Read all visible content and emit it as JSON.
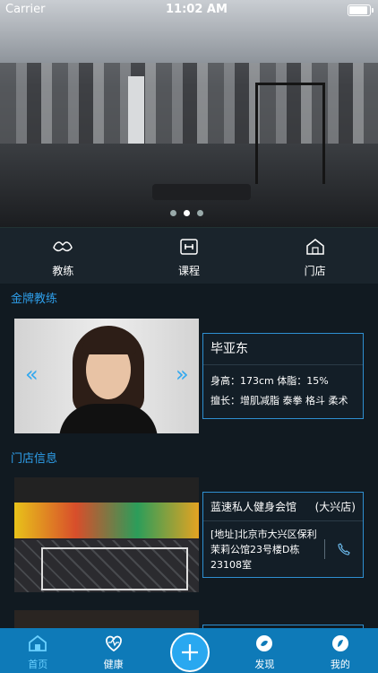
{
  "status": {
    "carrier": "Carrier",
    "time": "11:02 AM"
  },
  "hero": {
    "slides": 3,
    "active_index": 1
  },
  "quick_nav": [
    {
      "label": "教练",
      "icon": "muscle-icon"
    },
    {
      "label": "课程",
      "icon": "dumbbell-icon"
    },
    {
      "label": "门店",
      "icon": "store-icon"
    }
  ],
  "sections": {
    "coaches": "金牌教练",
    "stores": "门店信息"
  },
  "coach": {
    "name": "毕亚东",
    "stats": "身高：173cm   体脂：15%",
    "specialty": "擅长：增肌减脂  泰拳  格斗  柔术",
    "prev": "«",
    "next": "»"
  },
  "store": {
    "name": "蓝速私人健身会馆",
    "district": "(大兴店)",
    "address": "[地址]北京市大兴区保利茉莉公馆23号楼D栋23108室"
  },
  "tabs": [
    {
      "label": "首页",
      "icon": "home-icon",
      "active": true
    },
    {
      "label": "健康",
      "icon": "heart-icon",
      "active": false
    },
    {
      "label": "",
      "icon": "plus-icon",
      "active": false
    },
    {
      "label": "发现",
      "icon": "discover-icon",
      "active": false
    },
    {
      "label": "我的",
      "icon": "profile-icon",
      "active": false
    }
  ],
  "colors": {
    "accent": "#2e9ee9",
    "tabbar": "#0e7ab8",
    "background": "#111a21"
  }
}
